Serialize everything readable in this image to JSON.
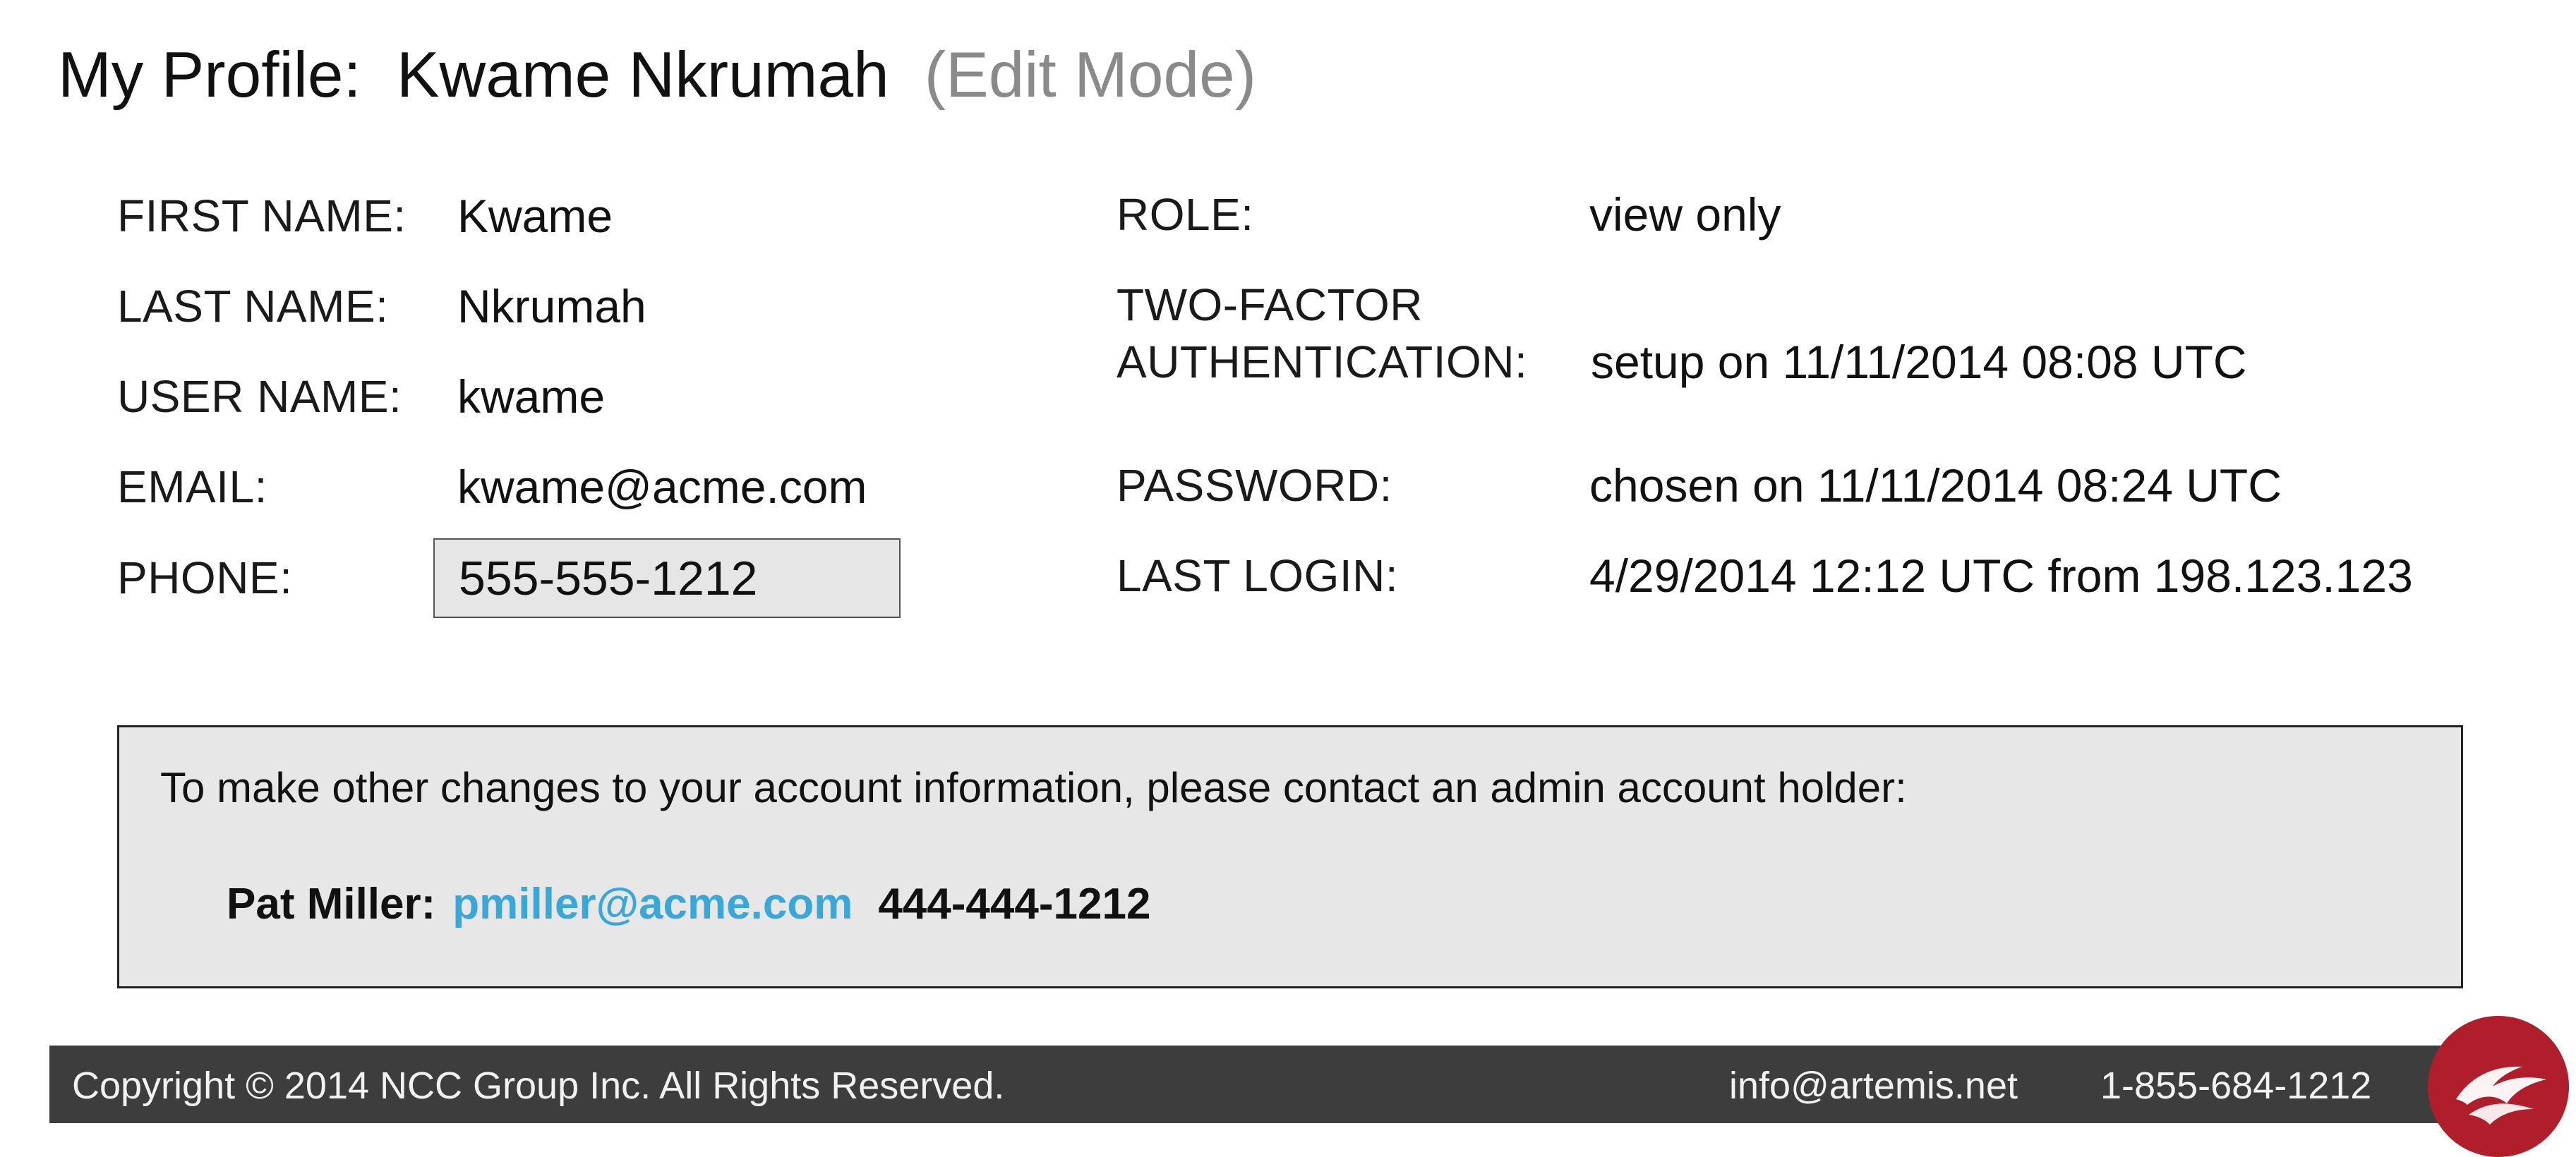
{
  "header": {
    "title_prefix": "My Profile:",
    "user_full_name": "Kwame Nkrumah",
    "mode_label": "(Edit Mode)"
  },
  "profile": {
    "first_name": {
      "label": "FIRST NAME:",
      "value": "Kwame"
    },
    "last_name": {
      "label": "LAST NAME:",
      "value": "Nkrumah"
    },
    "user_name": {
      "label": "USER NAME:",
      "value": "kwame"
    },
    "email": {
      "label": "EMAIL:",
      "value": "kwame@acme.com"
    },
    "phone": {
      "label": "PHONE:",
      "value": "555-555-1212"
    }
  },
  "account": {
    "role": {
      "label": "ROLE:",
      "value": "view only"
    },
    "two_factor": {
      "label_line1": "TWO-FACTOR",
      "label_line2": "AUTHENTICATION:",
      "value": "setup on 11/11/2014 08:08 UTC"
    },
    "password": {
      "label": "PASSWORD:",
      "value": "chosen on 11/11/2014 08:24 UTC"
    },
    "last_login": {
      "label": "LAST LOGIN:",
      "value": "4/29/2014 12:12 UTC from 198.123.123"
    }
  },
  "contact_box": {
    "intro": "To make other changes to your account information, please contact an admin account holder:",
    "admin_name": "Pat Miller:",
    "admin_email": "pmiller@acme.com",
    "admin_phone": "444-444-1212"
  },
  "footer": {
    "copyright": "Copyright © 2014 NCC Group Inc.  All Rights Reserved.",
    "email": "info@artemis.net",
    "phone": "1-855-684-1212"
  },
  "colors": {
    "link": "#3aa7d9",
    "footer_bg": "#3d3d3d",
    "contact_box_bg": "#e7e7e7",
    "logo_red": "#b01e2b",
    "mode_label_gray": "#8a8a8a"
  },
  "icons": {
    "brand_logo": "artemis-logo-icon"
  }
}
